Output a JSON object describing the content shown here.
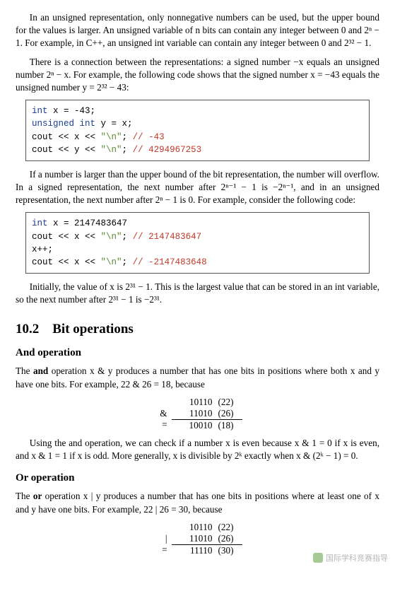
{
  "para1": "In an unsigned representation, only nonnegative numbers can be used, but the upper bound for the values is larger. An unsigned variable of n bits can contain any integer between 0 and 2ⁿ − 1. For example, in C++, an unsigned int variable can contain any integer between 0 and 2³² − 1.",
  "para2": "There is a connection between the representations: a signed number −x equals an unsigned number 2ⁿ − x. For example, the following code shows that the signed number x = −43 equals the unsigned number y = 2³² − 43:",
  "code1": {
    "l1_a": "int",
    "l1_b": " x = -43;",
    "l2_a": "unsigned int",
    "l2_b": " y = x;",
    "l3_a": "cout << x << ",
    "l3_b": "\"\\n\"",
    "l3_c": "; ",
    "l3_d": "// -43",
    "l4_a": "cout << y << ",
    "l4_b": "\"\\n\"",
    "l4_c": "; ",
    "l4_d": "// 4294967253"
  },
  "para3": "If a number is larger than the upper bound of the bit representation, the number will overflow. In a signed representation, the next number after 2ⁿ⁻¹ − 1 is −2ⁿ⁻¹, and in an unsigned representation, the next number after 2ⁿ − 1 is 0. For example, consider the following code:",
  "code2": {
    "l1_a": "int",
    "l1_b": " x = 2147483647",
    "l2_a": "cout << x << ",
    "l2_b": "\"\\n\"",
    "l2_c": "; ",
    "l2_d": "// 2147483647",
    "l3": "x++;",
    "l4_a": "cout << x << ",
    "l4_b": "\"\\n\"",
    "l4_c": "; ",
    "l4_d": "// -2147483648"
  },
  "para4": "Initially, the value of x is 2³¹ − 1. This is the largest value that can be stored in an int variable, so the next number after 2³¹ − 1 is −2³¹.",
  "section_title": "10.2 Bit operations",
  "and_heading": "And operation",
  "and_para_a": "The ",
  "and_para_b": "and",
  "and_para_c": " operation x & y produces a number that has one bits in positions where both x and y have one bits. For example, 22 & 26 = 18, because",
  "and_table": {
    "r1": {
      "op": "",
      "bin": "10110",
      "dec": "(22)"
    },
    "r2": {
      "op": "&",
      "bin": "11010",
      "dec": "(26)"
    },
    "r3": {
      "op": "=",
      "bin": "10010",
      "dec": "(18)"
    }
  },
  "and_para2": "Using the and operation, we can check if a number x is even because x & 1 = 0 if x is even, and x & 1 = 1 if x is odd. More generally, x is divisible by 2ᵏ exactly when x & (2ᵏ − 1) = 0.",
  "or_heading": "Or operation",
  "or_para_a": "The ",
  "or_para_b": "or",
  "or_para_c": " operation x | y produces a number that has one bits in positions where at least one of x and y have one bits. For example, 22 | 26 = 30, because",
  "or_table": {
    "r1": {
      "op": "",
      "bin": "10110",
      "dec": "(22)"
    },
    "r2": {
      "op": "|",
      "bin": "11010",
      "dec": "(26)"
    },
    "r3": {
      "op": "=",
      "bin": "11110",
      "dec": "(30)"
    }
  },
  "watermark_text": "国际学科竞赛指导"
}
